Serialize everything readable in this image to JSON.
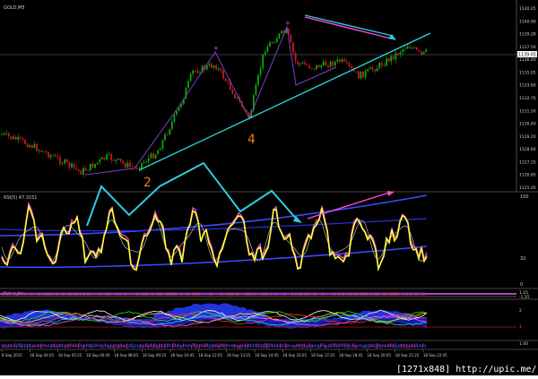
{
  "window": {
    "symbol_title": "GOLD,M5"
  },
  "main_chart": {
    "price_labels": [
      "1140.25",
      "1140.90",
      "1139.28",
      "1137.50",
      "1136.40",
      "1135.05",
      "1133.60",
      "1132.70",
      "1131.50",
      "1130.40",
      "1129.20",
      "1128.60",
      "1127.25",
      "1126.85",
      "1125.00"
    ],
    "current_price": "1139.05",
    "wave_labels": [
      "2",
      "4"
    ],
    "colors": {
      "background": "#000000",
      "bull_candle": "#0ea80e",
      "bear_candle": "#c21d1d",
      "trendline": "#28d7d7",
      "wave_line": "#7b3fbf",
      "wave_label": "#f07a16",
      "arrow": "#36c4e0",
      "pink": "#ff48d8"
    }
  },
  "rsi_panel": {
    "label": "RSI(5) 47.3151",
    "levels": [
      "100",
      "50",
      "32",
      "0"
    ],
    "colors": {
      "rsi": "#ffff32",
      "band": "#4b63ff",
      "zigzag": "#2ecbe1"
    }
  },
  "indicator_panels": [
    {
      "label": "Fisher_1m",
      "values": [
        "1.25",
        "-1.25"
      ]
    },
    {
      "label": "Multi-indicator",
      "values": [
        "2",
        "1"
      ]
    },
    {
      "label": "Oscillator",
      "values": [
        "1.00",
        "0"
      ]
    }
  ],
  "time_axis": [
    "8 Sep 2015",
    "18 Sep 04:05",
    "18 Sep 05:25",
    "18 Sep 06:45",
    "18 Sep 08:05",
    "18 Sep 09:25",
    "18 Sep 10:45",
    "18 Sep 12:05",
    "18 Sep 13:25",
    "18 Sep 14:45",
    "18 Sep 16:05",
    "18 Sep 17:25",
    "18 Sep 18:45",
    "18 Sep 20:05",
    "18 Sep 21:25",
    "18 Sep 22:45"
  ],
  "watermark": "[1271x848] http://upic.me/"
}
